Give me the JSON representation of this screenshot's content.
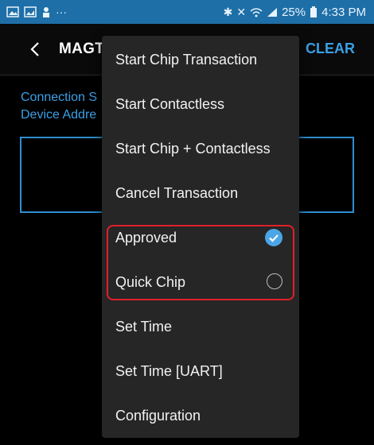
{
  "status_bar": {
    "left_icons": [
      "image-icon",
      "gallery-icon",
      "person-icon",
      "more-dots-icon"
    ],
    "right_icons": [
      "bluetooth-icon",
      "mute-icon",
      "wifi-icon",
      "signal-icon"
    ],
    "battery": "25%",
    "time": "4:33 PM"
  },
  "app_bar": {
    "title": "MAGTI",
    "clear_label": "CLEAR"
  },
  "content": {
    "connection_label": "Connection S",
    "device_label": "Device Addre"
  },
  "menu": {
    "items": [
      {
        "label": "Start Chip Transaction"
      },
      {
        "label": "Start Contactless"
      },
      {
        "label": "Start Chip + Contactless"
      },
      {
        "label": "Cancel Transaction"
      },
      {
        "label": "Approved",
        "checked": true
      },
      {
        "label": "Quick Chip",
        "checked": false
      },
      {
        "label": "Set Time"
      },
      {
        "label": "Set Time [UART]"
      },
      {
        "label": "Configuration"
      }
    ]
  },
  "colors": {
    "status_bar": "#1e6fa8",
    "accent": "#3aa0e6",
    "highlight": "#e0202a",
    "menu_bg": "#262626"
  }
}
